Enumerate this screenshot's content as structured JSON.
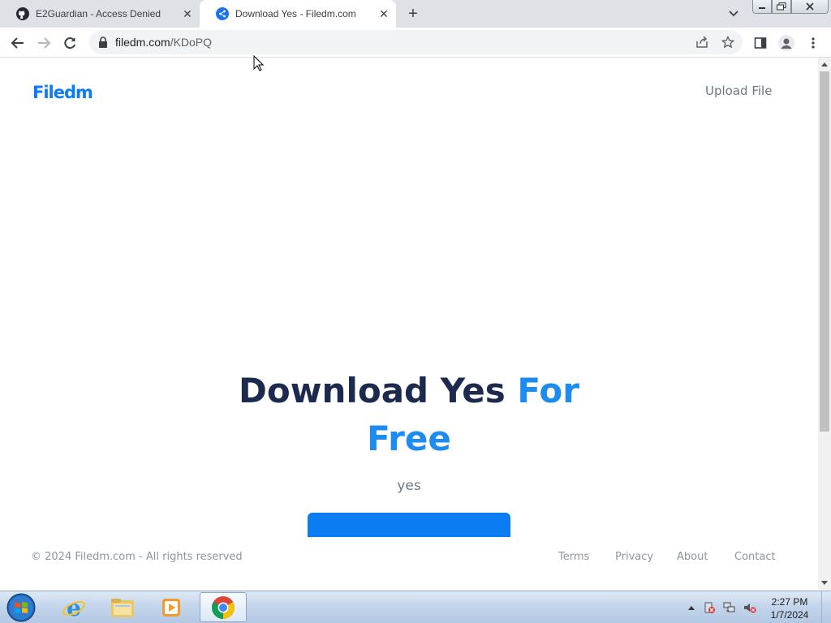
{
  "browser": {
    "tabs": [
      {
        "title": "E2Guardian - Access Denied",
        "favicon": "github-icon",
        "active": false
      },
      {
        "title": "Download Yes - Filedm.com",
        "favicon": "share-icon",
        "active": true
      }
    ],
    "url_host": "filedm.com",
    "url_path": "/KDoPQ"
  },
  "page": {
    "logo": "Filedm",
    "nav_upload": "Upload File",
    "headline_part1": "Download Yes",
    "headline_accent1": "For",
    "headline_accent2": "Free",
    "subtitle": "yes",
    "footer": {
      "copyright": "© 2024 Filedm.com - All rights reserved",
      "links": [
        "Terms",
        "Privacy",
        "About",
        "Contact"
      ]
    },
    "colors": {
      "brand": "#0c7cf2",
      "heading": "#1b2a4e",
      "muted": "#6b7785"
    }
  },
  "taskbar": {
    "apps": [
      "ie-icon",
      "explorer-icon",
      "media-player-icon",
      "chrome-icon"
    ],
    "time": "2:27 PM",
    "date": "1/7/2024"
  }
}
